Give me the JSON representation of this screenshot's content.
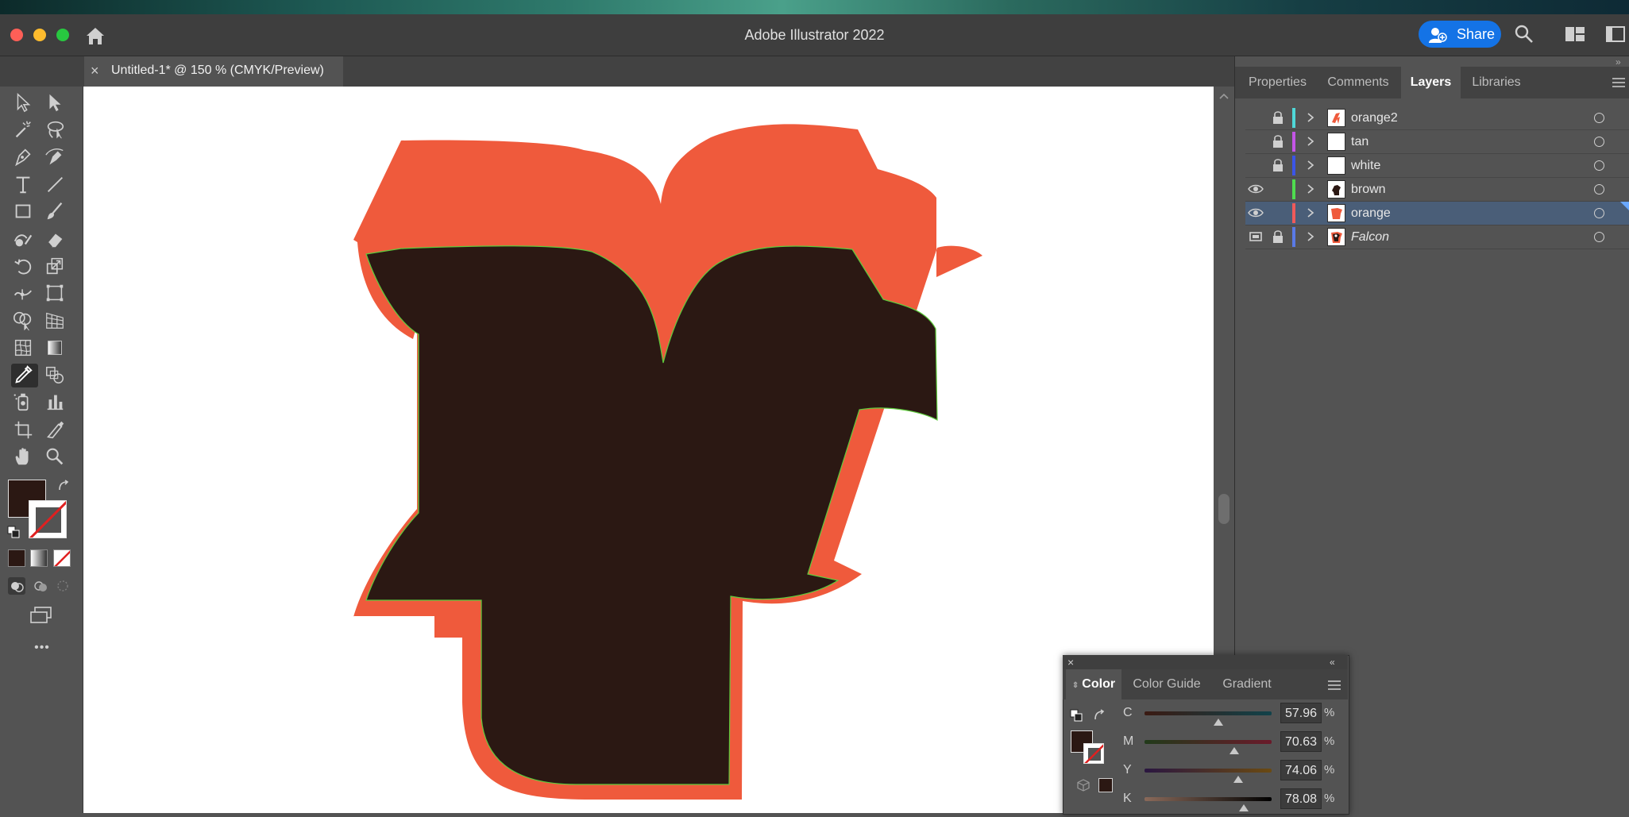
{
  "window": {
    "title": "Adobe Illustrator 2022",
    "share_label": "Share"
  },
  "document": {
    "tab_label": "Untitled-1* @ 150 % (CMYK/Preview)",
    "close_symbol": "×"
  },
  "colors": {
    "accent": "#1473e6",
    "fill": "#2b1813",
    "stroke_orange": "#ef5a3c",
    "selection_path": "#5ecb3c"
  },
  "panel_tabs": [
    {
      "label": "Properties",
      "active": false
    },
    {
      "label": "Comments",
      "active": false
    },
    {
      "label": "Layers",
      "active": true
    },
    {
      "label": "Libraries",
      "active": false
    }
  ],
  "layers": [
    {
      "name": "orange2",
      "color": "#4fd8d8",
      "visible": false,
      "locked": true,
      "selected": false,
      "italic": false,
      "thumb": "orange-mark"
    },
    {
      "name": "tan",
      "color": "#c455e6",
      "visible": false,
      "locked": true,
      "selected": false,
      "italic": false,
      "thumb": "blank"
    },
    {
      "name": "white",
      "color": "#3b55e6",
      "visible": false,
      "locked": true,
      "selected": false,
      "italic": false,
      "thumb": "blank"
    },
    {
      "name": "brown",
      "color": "#4fdc4f",
      "visible": true,
      "locked": false,
      "selected": false,
      "italic": false,
      "thumb": "brown-shape"
    },
    {
      "name": "orange",
      "color": "#ef5a5a",
      "visible": true,
      "locked": false,
      "selected": true,
      "italic": false,
      "thumb": "orange-shape"
    },
    {
      "name": "Falcon",
      "color": "#5a7ae6",
      "visible": true,
      "locked": true,
      "selected": false,
      "italic": true,
      "thumb": "falcon"
    }
  ],
  "color_panel": {
    "tabs": [
      {
        "label": "Color",
        "active": true
      },
      {
        "label": "Color Guide",
        "active": false
      },
      {
        "label": "Gradient",
        "active": false
      }
    ],
    "sliders": [
      {
        "label": "C",
        "value": "57.96",
        "fraction": 0.5796
      },
      {
        "label": "M",
        "value": "70.63",
        "fraction": 0.7063
      },
      {
        "label": "Y",
        "value": "74.06",
        "fraction": 0.7406
      },
      {
        "label": "K",
        "value": "78.08",
        "fraction": 0.7808
      }
    ],
    "percent": "%"
  },
  "toolbar": {
    "more_symbol": "•••",
    "tools": [
      "selection-tool",
      "direct-selection-tool",
      "magic-wand-tool",
      "lasso-tool",
      "pen-tool",
      "curvature-tool",
      "type-tool",
      "line-segment-tool",
      "rectangle-tool",
      "paintbrush-tool",
      "shaper-tool",
      "eraser-tool",
      "rotate-tool",
      "scale-tool",
      "width-tool",
      "free-transform-tool",
      "shape-builder-tool",
      "perspective-grid-tool",
      "mesh-tool",
      "gradient-tool",
      "eyedropper-tool",
      "blend-tool",
      "symbol-sprayer-tool",
      "column-graph-tool",
      "artboard-tool",
      "slice-tool",
      "hand-tool",
      "zoom-tool"
    ]
  }
}
